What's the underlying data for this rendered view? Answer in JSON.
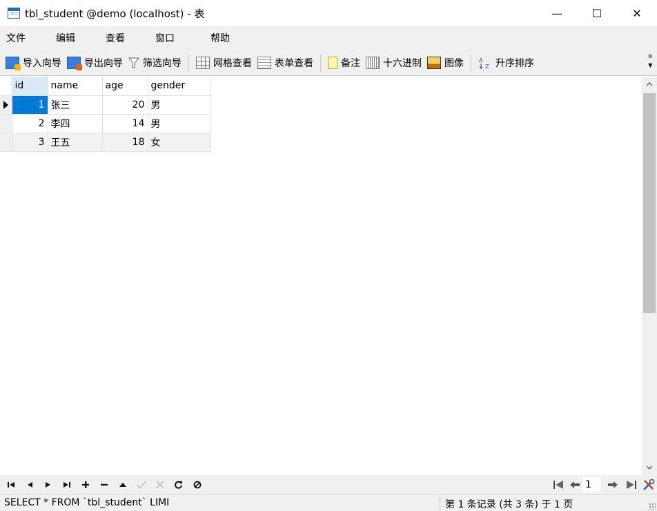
{
  "window": {
    "title": "tbl_student @demo (localhost) - 表",
    "minimize": "—",
    "maximize": "☐",
    "close": "✕"
  },
  "menu": [
    "文件",
    "编辑",
    "查看",
    "窗口",
    "帮助"
  ],
  "toolbar": {
    "import": "导入向导",
    "export": "导出向导",
    "filter": "筛选向导",
    "grid_view": "网格查看",
    "form_view": "表单查看",
    "memo": "备注",
    "hex": "十六进制",
    "image": "图像",
    "sort": "升序排序",
    "overflow": "»"
  },
  "table": {
    "columns": [
      "id",
      "name",
      "age",
      "gender"
    ],
    "rows": [
      {
        "id": "1",
        "name": "张三",
        "age": "20",
        "gender": "男"
      },
      {
        "id": "2",
        "name": "李四",
        "age": "14",
        "gender": "男"
      },
      {
        "id": "3",
        "name": "王五",
        "age": "18",
        "gender": "女"
      }
    ],
    "selected_row": 0
  },
  "navigator": {
    "current_page": "1"
  },
  "status": {
    "sql": "SELECT * FROM `tbl_student` LIMI",
    "records": "第 1 条记录 (共 3 条) 于 1 页"
  },
  "colors": {
    "selection": "#0078d7",
    "header_highlight": "#dbe8f6",
    "chrome": "#f0f0f0"
  }
}
